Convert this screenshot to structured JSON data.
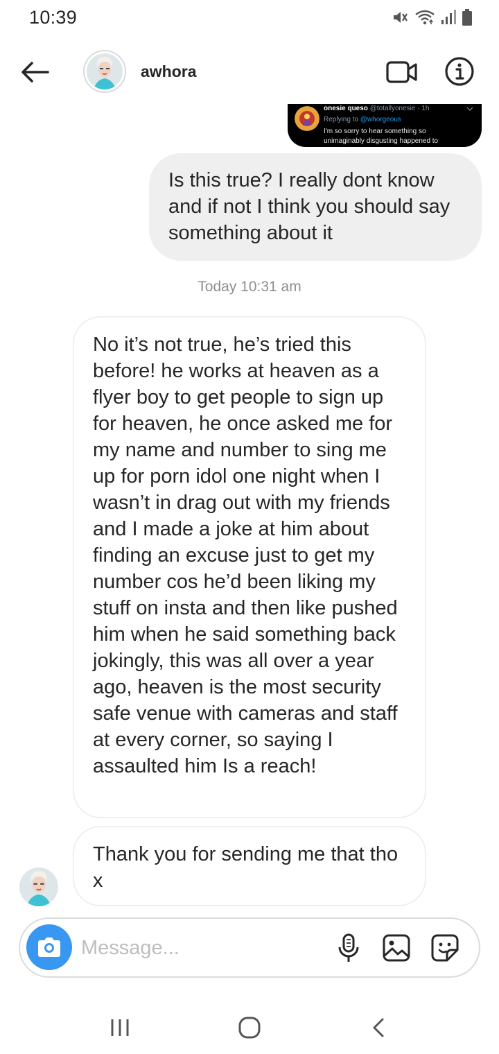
{
  "status_bar": {
    "time": "10:39",
    "icons": [
      "mute-icon",
      "wifi-icon",
      "signal-icon",
      "battery-icon"
    ]
  },
  "header": {
    "name": "awhora",
    "icons": [
      "back-arrow-icon",
      "video-call-icon",
      "info-icon"
    ]
  },
  "shared_tweet": {
    "display_name": "onesie queso",
    "handle": "@totallyonesie · 1h",
    "replying_prefix": "Replying to ",
    "replying_to": "@whorgeous",
    "text_line1": "I'm so sorry to hear something so",
    "text_line2": "unimaginably disgusting happened to"
  },
  "messages": {
    "outgoing_1": "Is this true? I really dont know and if not I think you should say something about it",
    "timestamp": "Today 10:31 am",
    "incoming_1": "No it’s not true, he’s tried this before! he works at heaven as a flyer boy to get people to sign up for heaven, he once asked me for my name and number to sing me up for porn idol one night when I wasn’t in drag out with my friends and I made a joke at him about finding an excuse just to get my number cos he’d been liking my stuff on insta and then like pushed him when he said something back jokingly, this was all over a year ago, heaven is the most security safe venue with cameras and staff at every corner, so saying I assaulted him Is a reach!",
    "incoming_2": "Thank you for sending me that tho x"
  },
  "composer": {
    "placeholder": "Message...",
    "icons": [
      "camera-icon",
      "microphone-icon",
      "gallery-icon",
      "sticker-icon"
    ]
  },
  "colors": {
    "accent_blue": "#3897f0",
    "outgoing_bubble": "#efefef",
    "border": "#dbdbdb",
    "muted_text": "#8e8e8e"
  }
}
